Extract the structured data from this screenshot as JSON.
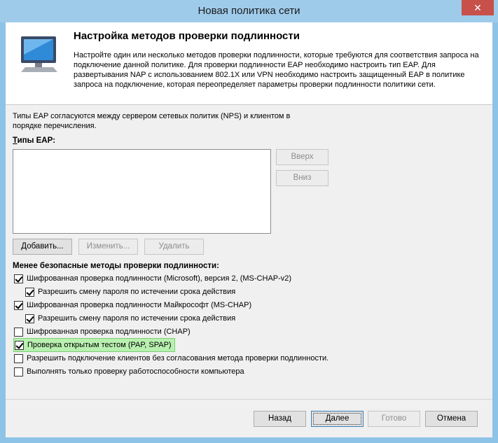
{
  "window": {
    "title": "Новая политика сети",
    "close_glyph": "✕"
  },
  "header": {
    "title": "Настройка методов проверки подлинности",
    "description": "Настройте один или несколько методов проверки подлинности, которые требуются для соответствия запроса на подключение данной политике. Для проверки подлинности EAP необходимо настроить тип EAP. Для развертывания NAP с использованием 802.1X или VPN необходимо настроить защищенный EAP в политике запроса на подключение, которая переопределяет параметры проверки подлинности политики сети.",
    "icon": "monitor-icon"
  },
  "intro_text": "Типы EAP согласуются между сервером сетевых политик (NPS) и клиентом в порядке перечисления.",
  "eap": {
    "label_accel": "Т",
    "label_rest": "ипы EAP:",
    "items": [],
    "up_button": "Вверх",
    "down_button": "Вниз",
    "add_button": "Добавить...",
    "edit_button": "Изменить...",
    "remove_button": "Удалить"
  },
  "less_secure": {
    "label": "Менее безопасные методы проверки подлинности:",
    "options": [
      {
        "label": "Шифрованная проверка подлинности (Microsoft), версия 2, (MS-CHAP-v2)",
        "checked": true
      },
      {
        "label": "Разрешить смену пароля по истечении срока действия",
        "checked": true
      },
      {
        "label": "Шифрованная проверка подлинности Майкрософт (MS-CHAP)",
        "checked": true
      },
      {
        "label": "Разрешить смену пароля по истечении срока действия",
        "checked": true
      },
      {
        "label": "Шифрованная проверка подлинности (CHAP)",
        "checked": false
      },
      {
        "label": "Проверка открытым тестом (PAP, SPAP)",
        "checked": true
      },
      {
        "label": "Разрешить подключение клиентов без согласования метода проверки подлинности.",
        "checked": false
      },
      {
        "label": "Выполнять только проверку работоспособности компьютера",
        "checked": false
      }
    ]
  },
  "footer": {
    "back_button": "Назад",
    "next_button": "Далее",
    "finish_button": "Готово",
    "cancel_button": "Отмена"
  },
  "colors": {
    "title_bar": "#9fcbeb",
    "close_button": "#c7504a",
    "highlight": "#b8f0b0"
  }
}
